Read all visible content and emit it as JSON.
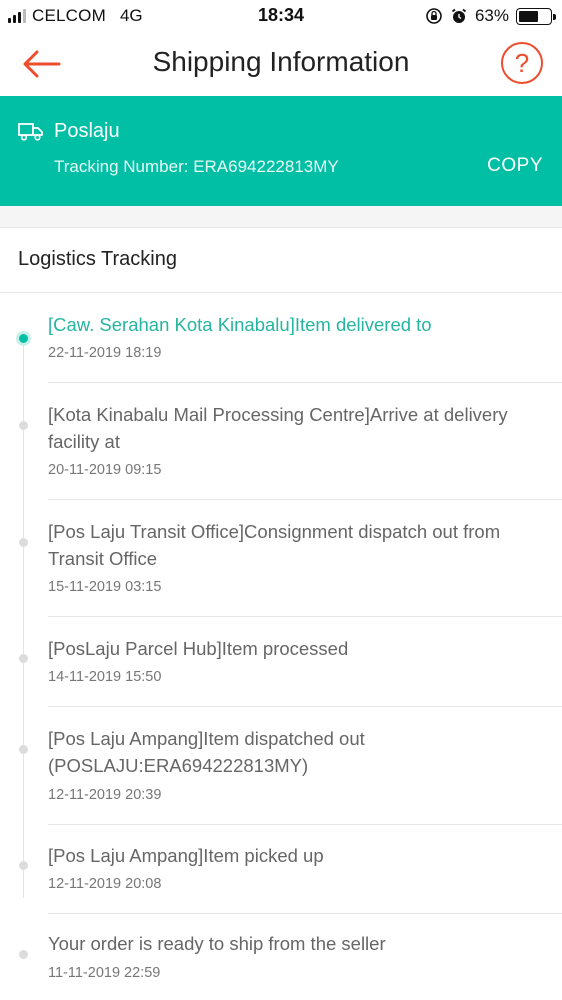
{
  "status_bar": {
    "carrier": "CELCOM",
    "network": "4G",
    "time": "18:34",
    "battery": "63%",
    "battery_level": 0.63
  },
  "header": {
    "title": "Shipping Information",
    "back_icon": "arrow-left-icon",
    "help_label": "?"
  },
  "banner": {
    "courier": "Poslaju",
    "tracking": "Tracking Number: ERA694222813MY",
    "copy_label": "COPY",
    "icon": "truck-icon"
  },
  "section": {
    "title": "Logistics Tracking"
  },
  "colors": {
    "accent": "#ee4d2d",
    "banner": "#00bfa5",
    "active_text": "#26b5a0"
  },
  "events": [
    {
      "text": "[Caw. Serahan Kota Kinabalu]Item delivered to",
      "time": "22-11-2019 18:19",
      "active": true
    },
    {
      "text": "[Kota Kinabalu Mail Processing Centre]Arrive at delivery facility at",
      "time": "20-11-2019 09:15",
      "active": false
    },
    {
      "text": "[Pos Laju Transit Office]Consignment dispatch out from Transit Office",
      "time": "15-11-2019 03:15",
      "active": false
    },
    {
      "text": "[PosLaju Parcel Hub]Item processed",
      "time": "14-11-2019 15:50",
      "active": false
    },
    {
      "text": "[Pos Laju Ampang]Item dispatched out (POSLAJU:ERA694222813MY)",
      "time": "12-11-2019 20:39",
      "active": false
    },
    {
      "text": "[Pos Laju Ampang]Item picked up",
      "time": "12-11-2019 20:08",
      "active": false
    },
    {
      "text": "Your order is ready to ship from the seller",
      "time": "11-11-2019 22:59",
      "active": false
    }
  ]
}
